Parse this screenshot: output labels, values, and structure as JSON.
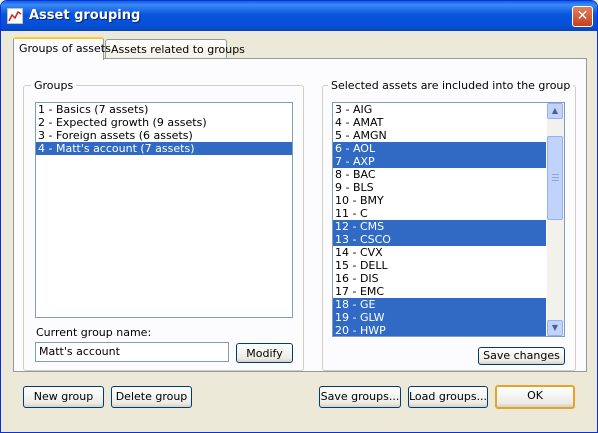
{
  "window": {
    "title": "Asset grouping",
    "close_glyph": "✕"
  },
  "tabs": [
    {
      "label": "Groups of assets",
      "active": true
    },
    {
      "label": "Assets related to groups",
      "active": false
    }
  ],
  "groups_box": {
    "title": "Groups",
    "items": [
      {
        "label": "1 - Basics (7 assets)",
        "selected": false
      },
      {
        "label": "2 - Expected growth (9 assets)",
        "selected": false
      },
      {
        "label": "3 - Foreign assets (6 assets)",
        "selected": false
      },
      {
        "label": "4 - Matt's account (7 assets)",
        "selected": true
      }
    ],
    "current_group_label": "Current group name:",
    "current_group_value": "Matt's account",
    "modify_label": "Modify"
  },
  "assets_box": {
    "title": "Selected assets are included into the group",
    "items": [
      {
        "label": "3 - AIG",
        "selected": false
      },
      {
        "label": "4 - AMAT",
        "selected": false
      },
      {
        "label": "5 - AMGN",
        "selected": false
      },
      {
        "label": "6 - AOL",
        "selected": true
      },
      {
        "label": "7 - AXP",
        "selected": true
      },
      {
        "label": "8 - BAC",
        "selected": false
      },
      {
        "label": "9 - BLS",
        "selected": false
      },
      {
        "label": "10 - BMY",
        "selected": false
      },
      {
        "label": "11 - C",
        "selected": false
      },
      {
        "label": "12 - CMS",
        "selected": true
      },
      {
        "label": "13 - CSCO",
        "selected": true
      },
      {
        "label": "14 - CVX",
        "selected": false
      },
      {
        "label": "15 - DELL",
        "selected": false
      },
      {
        "label": "16 - DIS",
        "selected": false
      },
      {
        "label": "17 - EMC",
        "selected": false
      },
      {
        "label": "18 - GE",
        "selected": true
      },
      {
        "label": "19 - GLW",
        "selected": true
      },
      {
        "label": "20 - HWP",
        "selected": true
      }
    ],
    "save_changes_label": "Save changes"
  },
  "footer": {
    "new_group_label": "New group",
    "delete_group_label": "Delete group",
    "save_groups_label": "Save groups...",
    "load_groups_label": "Load groups...",
    "ok_label": "OK"
  },
  "colors": {
    "selection": "#316ac5",
    "titlebar": "#0855dd",
    "close_button": "#c5401c",
    "default_button_border": "#e5a32a"
  }
}
